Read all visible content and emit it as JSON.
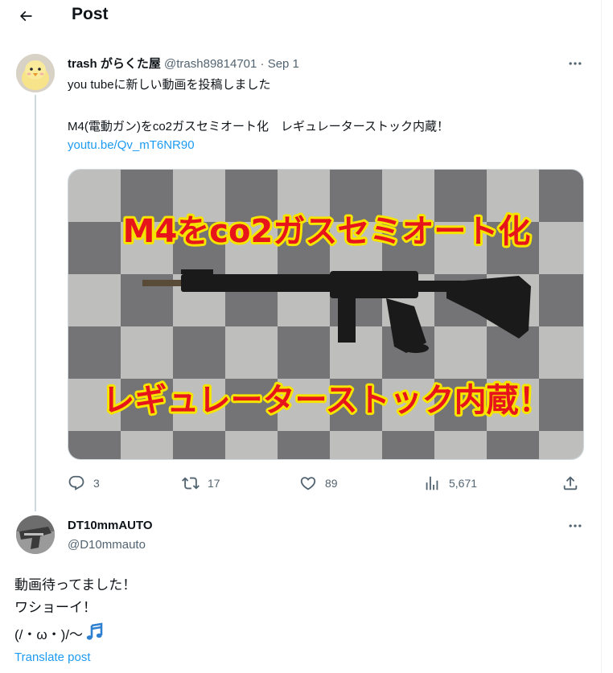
{
  "header": {
    "title": "Post",
    "back_icon": "arrow-left-icon"
  },
  "post": {
    "display_name": "trash がらくた屋",
    "handle": "@trash89814701",
    "separator": " · ",
    "date": "Sep 1",
    "text_line1": "you tubeに新しい動画を投稿しました",
    "text_line2": "M4(電動ガン)をco2ガスセミオート化　レギュレーターストック内蔵！",
    "link": "youtu.be/Qv_mT6NR90",
    "media": {
      "overlay_top": "M4をco2ガスセミオート化",
      "overlay_bottom": "レギュレーターストック内蔵！",
      "overlay_color": "#e8141b",
      "overlay_outline": "#f5e400"
    },
    "stats": {
      "replies": "3",
      "reposts": "17",
      "likes": "89",
      "views": "5,671"
    }
  },
  "reply": {
    "display_name": "DT10mmAUTO",
    "handle": "@D10mmauto",
    "text_line1": "動画待ってました！",
    "text_line2": "ワショーイ！",
    "text_line3": "(/・ω・)/〜",
    "emoji": "musical-notes-icon",
    "translate_label": "Translate post"
  },
  "colors": {
    "text": "#0f1419",
    "secondary": "#536471",
    "accent": "#1d9bf0",
    "border": "#eff3f4",
    "thread_line": "#cfd9de"
  }
}
